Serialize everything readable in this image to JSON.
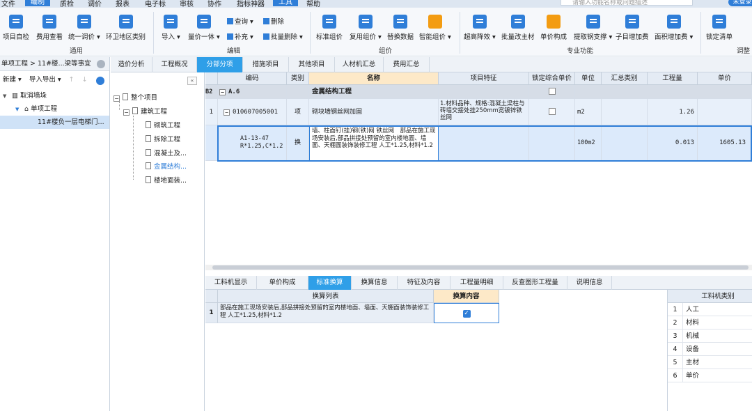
{
  "menu": [
    "文件",
    "编制",
    "质检",
    "调价",
    "报表",
    "电子标",
    "审核",
    "协作",
    "指标神器",
    "工具",
    "帮助"
  ],
  "menu_active": "编制",
  "menu_highlight": "工具",
  "search_placeholder": "请输入功能名称或问题描述",
  "login_label": "未登录",
  "ribbon": {
    "general": {
      "label": "通用",
      "items": [
        "项目自检",
        "费用查看",
        "统一调价 ▾",
        "环卫地区类别"
      ]
    },
    "edit": {
      "label": "编辑",
      "items": [
        "导入 ▾",
        "量价一体 ▾"
      ],
      "small": [
        "查询 ▾",
        "删除",
        "补充 ▾",
        "批量删除 ▾"
      ]
    },
    "group": {
      "label": "组价",
      "items": [
        "标准组价",
        "复用组价 ▾",
        "替换数据",
        "智能组价 ▾"
      ]
    },
    "pro": {
      "label": "专业功能",
      "items": [
        "超高降效 ▾",
        "批量改主材",
        "单价构成",
        "提取钢支撑 ▾",
        "子目增加费",
        "面积增加费 ▾"
      ]
    },
    "adjust": {
      "label": "调整",
      "items": [
        "锁定清单"
      ]
    }
  },
  "left": {
    "breadcrumb": "单项工程 > 11#楼...梁等事宜",
    "toolbar": [
      "新建 ▾",
      "导入导出 ▾",
      "↑",
      "↓"
    ],
    "tree": [
      {
        "label": "取消墙垛",
        "level": 0
      },
      {
        "label": "单项工程",
        "level": 1
      },
      {
        "label": "11#楼负一层电梯门...",
        "level": 2
      }
    ]
  },
  "tabs": [
    "造价分析",
    "工程概况",
    "分部分项",
    "措施项目",
    "其他项目",
    "人材机汇总",
    "费用汇总"
  ],
  "tabs_active": "分部分项",
  "midtree": {
    "collapse": "«",
    "root": "整个项目",
    "branch": "建筑工程",
    "children": [
      "砌筑工程",
      "拆除工程",
      "混凝土及...",
      "金属结构...",
      "楼地面装..."
    ],
    "active_child": "金属结构..."
  },
  "grid": {
    "headers": [
      "",
      "编码",
      "类别",
      "名称",
      "项目特征",
      "锁定综合单价",
      "单位",
      "汇总类别",
      "工程量",
      "单价"
    ],
    "group_row": {
      "num": "B2",
      "code": "A.6",
      "name": "金属结构工程"
    },
    "item_row": {
      "num": "1",
      "code": "010607005001",
      "type": "项",
      "name": "砌块墙钢丝网加固",
      "feature": "1.材料品种、规格:混凝土梁柱与砖墙交接处挂250mm宽镀锌铁丝网",
      "unit": "m2",
      "qty": "1.26",
      "price": ""
    },
    "sub_row": {
      "code": "A1-13-47\nR*1.25,C*1.2",
      "type": "换",
      "name": "墙、柱面钉(挂)钢(铁)网 铁丝网　部品在施工现场安装后,部品拼接处预留的室内楼地面、墙面、天棚面装饰装修工程 人工*1.25,材料*1.2",
      "unit": "100m2",
      "qty": "0.013",
      "price": "1605.13"
    }
  },
  "btabs": [
    "工料机显示",
    "单价构成",
    "标准换算",
    "换算信息",
    "特征及内容",
    "工程量明细",
    "反查图形工程量",
    "说明信息"
  ],
  "btabs_active": "标准换算",
  "conv": {
    "headers": [
      "换算列表",
      "换算内容"
    ],
    "rows": [
      {
        "num": "1",
        "text": "部品在施工现场安装后,部品拼接处预留的室内楼地面、墙面、天棚面装饰装修工程 人工*1.25,材料*1.2",
        "checked": true
      }
    ]
  },
  "material": {
    "header": "工料机类别",
    "rows": [
      {
        "num": "1",
        "label": "人工"
      },
      {
        "num": "2",
        "label": "材料"
      },
      {
        "num": "3",
        "label": "机械"
      },
      {
        "num": "4",
        "label": "设备"
      },
      {
        "num": "5",
        "label": "主材"
      },
      {
        "num": "6",
        "label": "单价"
      }
    ]
  }
}
